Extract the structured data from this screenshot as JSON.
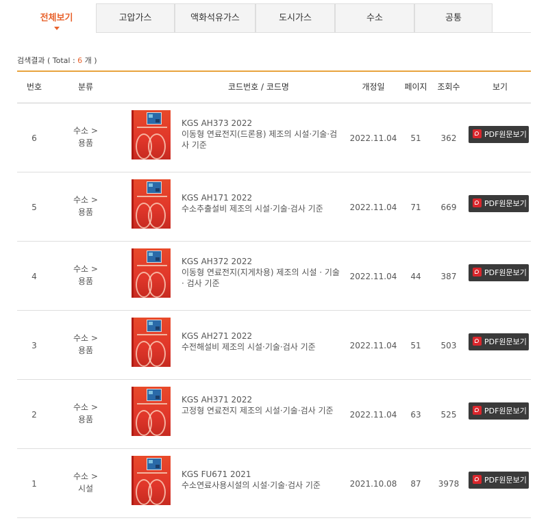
{
  "tabs": [
    {
      "label": "전체보기",
      "active": true
    },
    {
      "label": "고압가스",
      "active": false
    },
    {
      "label": "액화석유가스",
      "active": false
    },
    {
      "label": "도시가스",
      "active": false
    },
    {
      "label": "수소",
      "active": false
    },
    {
      "label": "공통",
      "active": false
    }
  ],
  "summary": {
    "prefix": "검색결과 ( Total : ",
    "count": "6",
    "suffix": " 개 )"
  },
  "table": {
    "headers": {
      "no": "번호",
      "category": "분류",
      "code": "코드번호 / 코드명",
      "date": "개정일",
      "pages": "페이지",
      "views": "조회수",
      "view_btn": "보기"
    },
    "button_label": "PDF원문보기",
    "rows": [
      {
        "no": "6",
        "cat1": "수소 >",
        "cat2": "용품",
        "code": "KGS AH373 2022",
        "name": "이동형 연료전지(드론용) 제조의 시설·기술·검사 기준",
        "date": "2022.11.04",
        "pages": "51",
        "views": "362"
      },
      {
        "no": "5",
        "cat1": "수소 >",
        "cat2": "용품",
        "code": "KGS AH171 2022",
        "name": "수소추출설비 제조의 시설·기술·검사 기준",
        "date": "2022.11.04",
        "pages": "71",
        "views": "669"
      },
      {
        "no": "4",
        "cat1": "수소 >",
        "cat2": "용품",
        "code": "KGS AH372 2022",
        "name": "이동형 연료전지(지게차용) 제조의 시설 · 기술 · 검사 기준",
        "date": "2022.11.04",
        "pages": "44",
        "views": "387"
      },
      {
        "no": "3",
        "cat1": "수소 >",
        "cat2": "용품",
        "code": "KGS AH271 2022",
        "name": "수전해설비 제조의 시설·기술·검사 기준",
        "date": "2022.11.04",
        "pages": "51",
        "views": "503"
      },
      {
        "no": "2",
        "cat1": "수소 >",
        "cat2": "용품",
        "code": "KGS AH371 2022",
        "name": "고정형 연료전지 제조의 시설·기술·검사 기준",
        "date": "2022.11.04",
        "pages": "63",
        "views": "525"
      },
      {
        "no": "1",
        "cat1": "수소 >",
        "cat2": "시설",
        "code": "KGS FU671 2021",
        "name": "수소연료사용시설의 시설·기술·검사 기준",
        "date": "2021.10.08",
        "pages": "87",
        "views": "3978"
      }
    ]
  },
  "colors": {
    "accent": "#e8622c",
    "header_border": "#e8a33c",
    "button_bg": "#3a3a3a",
    "pdf_icon": "#d9262c"
  },
  "icons": {
    "pdf": "pdf-icon",
    "cover": "book-cover-thumbnail"
  }
}
